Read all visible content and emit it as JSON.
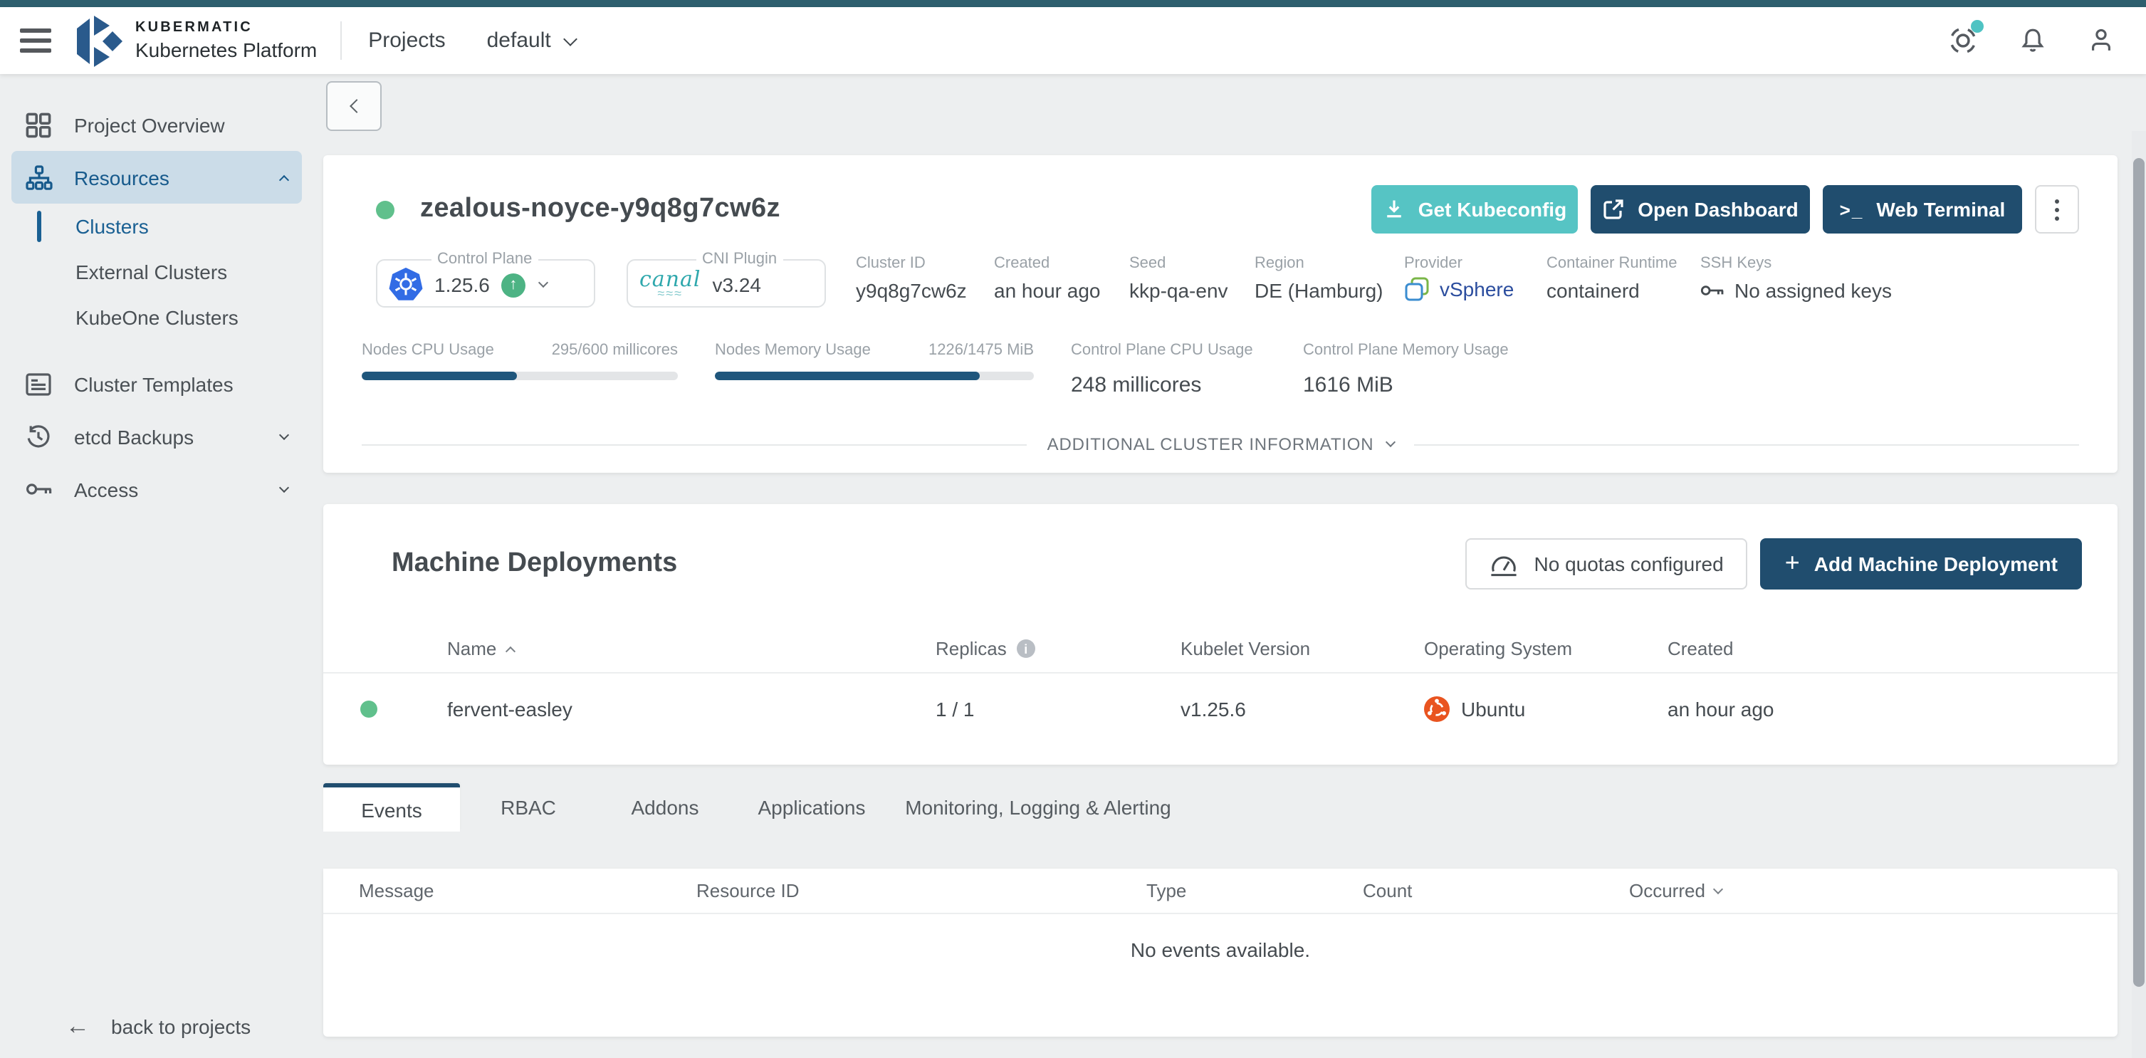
{
  "colors": {
    "accent_teal": "#56c4c4",
    "primary_navy": "#204d6e",
    "status_green": "#60c08c",
    "topstrip_teal": "#2e5f6e",
    "active_item_bg": "#cbdce8",
    "link_blue": "#1a6093",
    "kubernetes_blue": "#326ce5",
    "ubuntu_orange": "#e95420",
    "canal_teal": "#2fa8ad",
    "progress_navy": "#1f567c",
    "provider_link_blue": "#2b4d9e"
  },
  "icons": {
    "back_arrow": "←",
    "arrow_up": "↑",
    "plus": "+",
    "terminal": ">_",
    "info": "i",
    "canal_word": "canal",
    "canal_waves": "≈≈≈"
  },
  "topbar": {
    "brand_top": "KUBERMATIC",
    "brand_bottom": "Kubernetes Platform",
    "projects_label": "Projects",
    "project_selected": "default"
  },
  "sidebar": {
    "items": [
      {
        "label": "Project Overview"
      },
      {
        "label": "Resources"
      },
      {
        "label": "Clusters"
      },
      {
        "label": "External Clusters"
      },
      {
        "label": "KubeOne Clusters"
      },
      {
        "label": "Cluster Templates"
      },
      {
        "label": "etcd Backups"
      },
      {
        "label": "Access"
      }
    ],
    "back_link": "back to projects"
  },
  "cluster": {
    "name": "zealous-noyce-y9q8g7cw6z",
    "actions": {
      "get_kubeconfig": "Get Kubeconfig",
      "open_dashboard": "Open Dashboard",
      "web_terminal": "Web Terminal"
    },
    "control_plane": {
      "label": "Control Plane",
      "version": "1.25.6"
    },
    "cni": {
      "label": "CNI Plugin",
      "version": "v3.24"
    },
    "details": [
      {
        "label": "Cluster ID",
        "value": "y9q8g7cw6z"
      },
      {
        "label": "Created",
        "value": "an hour ago"
      },
      {
        "label": "Seed",
        "value": "kkp-qa-env"
      },
      {
        "label": "Region",
        "value": "DE (Hamburg)"
      },
      {
        "label": "Provider",
        "value": "vSphere"
      },
      {
        "label": "Container Runtime",
        "value": "containerd"
      },
      {
        "label": "SSH Keys",
        "value": "No assigned keys"
      }
    ],
    "usage": [
      {
        "label": "Nodes CPU Usage",
        "value": "295/600 millicores",
        "percent": 49.2
      },
      {
        "label": "Nodes Memory Usage",
        "value": "1226/1475 MiB",
        "percent": 83.1
      },
      {
        "label": "Control Plane CPU Usage",
        "value": "248 millicores"
      },
      {
        "label": "Control Plane Memory Usage",
        "value": "1616 MiB"
      }
    ],
    "additional_info_label": "ADDITIONAL CLUSTER INFORMATION"
  },
  "machine_deployments": {
    "title": "Machine Deployments",
    "quota_button": "No quotas configured",
    "add_button": "Add Machine Deployment",
    "columns": [
      "Name",
      "Replicas",
      "Kubelet Version",
      "Operating System",
      "Created"
    ],
    "rows": [
      {
        "name": "fervent-easley",
        "replicas": "1 / 1",
        "kubelet_version": "v1.25.6",
        "operating_system": "Ubuntu",
        "created": "an hour ago"
      }
    ]
  },
  "tabs": [
    {
      "label": "Events"
    },
    {
      "label": "RBAC"
    },
    {
      "label": "Addons"
    },
    {
      "label": "Applications"
    },
    {
      "label": "Monitoring, Logging & Alerting"
    }
  ],
  "events": {
    "columns": [
      "Message",
      "Resource ID",
      "Type",
      "Count",
      "Occurred"
    ],
    "empty_message": "No events available."
  }
}
